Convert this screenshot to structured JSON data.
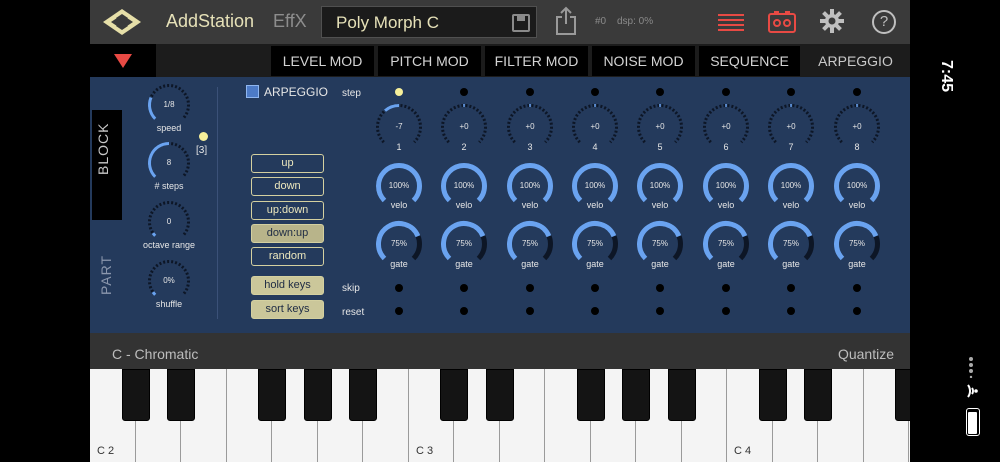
{
  "header": {
    "app_name": "AddStation",
    "effx_label": "EffX",
    "preset_name": "Poly Morph C",
    "program_number": "#0",
    "dsp_label": "dsp: 0%"
  },
  "tabs": [
    {
      "label": "LEVEL MOD"
    },
    {
      "label": "PITCH MOD"
    },
    {
      "label": "FILTER MOD"
    },
    {
      "label": "NOISE MOD"
    },
    {
      "label": "SEQUENCE"
    },
    {
      "label": "ARPEGGIO",
      "active": true
    }
  ],
  "side": {
    "block_label": "BLOCK",
    "part_label": "PART"
  },
  "arp_controls": {
    "speed": {
      "value": "1/8",
      "label": "speed",
      "level": 0.25
    },
    "steps": {
      "value": "8",
      "label": "# steps",
      "count": "[3]",
      "level": 0.5
    },
    "octave_range": {
      "value": "0",
      "label": "octave range",
      "level": 0.0
    },
    "shuffle": {
      "value": "0%",
      "label": "shuffle",
      "level": 0.0
    }
  },
  "arpeggio": {
    "toggle_label": "ARPEGGIO",
    "enabled": true
  },
  "modes": [
    "up",
    "down",
    "up:down",
    "down:up",
    "random"
  ],
  "mode_selected": "down:up",
  "key_buttons": [
    "hold keys",
    "sort keys"
  ],
  "row_labels": {
    "step": "step",
    "velo": "velo",
    "gate": "gate",
    "skip": "skip",
    "reset": "reset"
  },
  "steps": [
    {
      "num": "1",
      "pitch": "-7",
      "pitch_level": -0.3,
      "velo": "100%",
      "velo_level": 1.0,
      "gate": "75%",
      "gate_level": 0.75,
      "active": true
    },
    {
      "num": "2",
      "pitch": "+0",
      "pitch_level": 0.0,
      "velo": "100%",
      "velo_level": 1.0,
      "gate": "75%",
      "gate_level": 0.75,
      "active": false
    },
    {
      "num": "3",
      "pitch": "+0",
      "pitch_level": 0.0,
      "velo": "100%",
      "velo_level": 1.0,
      "gate": "75%",
      "gate_level": 0.75,
      "active": false
    },
    {
      "num": "4",
      "pitch": "+0",
      "pitch_level": 0.0,
      "velo": "100%",
      "velo_level": 1.0,
      "gate": "75%",
      "gate_level": 0.75,
      "active": false
    },
    {
      "num": "5",
      "pitch": "+0",
      "pitch_level": 0.0,
      "velo": "100%",
      "velo_level": 1.0,
      "gate": "75%",
      "gate_level": 0.75,
      "active": false
    },
    {
      "num": "6",
      "pitch": "+0",
      "pitch_level": 0.0,
      "velo": "100%",
      "velo_level": 1.0,
      "gate": "75%",
      "gate_level": 0.75,
      "active": false
    },
    {
      "num": "7",
      "pitch": "+0",
      "pitch_level": 0.0,
      "velo": "100%",
      "velo_level": 1.0,
      "gate": "75%",
      "gate_level": 0.75,
      "active": false
    },
    {
      "num": "8",
      "pitch": "+0",
      "pitch_level": 0.0,
      "velo": "100%",
      "velo_level": 1.0,
      "gate": "75%",
      "gate_level": 0.75,
      "active": false
    }
  ],
  "keyboard": {
    "scale": "C - Chromatic",
    "quantize": "Quantize",
    "octave_labels": [
      "C 2",
      "C 3",
      "C 4"
    ]
  },
  "status": {
    "time": "7:45"
  },
  "colors": {
    "panel": "#243a5c",
    "knob_arc": "#6aa3f0",
    "knob_track": "#0d1626",
    "led": "#f6ef9a",
    "accent_red": "#e84a44",
    "button_border": "#d4d0a0"
  }
}
